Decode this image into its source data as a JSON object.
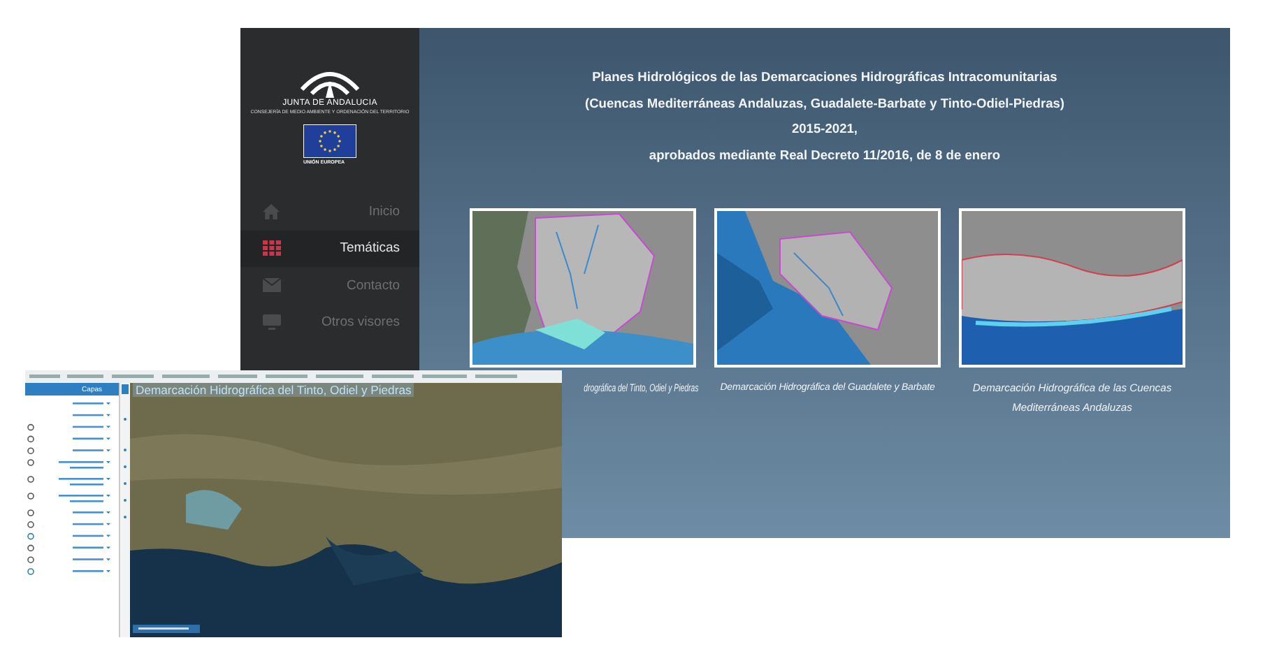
{
  "sidebar": {
    "logo_title": "JUNTA DE ANDALUCIA",
    "logo_subtitle": "CONSEJERÍA DE MEDIO AMBIENTE Y ORDENACIÓN DEL TERRITORIO",
    "eu_label": "UNIÓN EUROPEA",
    "items": [
      {
        "label": "Inicio",
        "kind": "home",
        "selected": false
      },
      {
        "label": "Temáticas",
        "kind": "grid",
        "selected": true
      },
      {
        "label": "Contacto",
        "kind": "mail",
        "selected": false
      },
      {
        "label": "Otros visores",
        "kind": "monitor",
        "selected": false
      }
    ]
  },
  "heading": {
    "lines": [
      "Planes Hidrológicos de las Demarcaciones Hidrográficas Intracomunitarias",
      "(Cuencas Mediterráneas Andaluzas, Guadalete-Barbate y Tinto-Odiel-Piedras)",
      "2015-2021,",
      "aprobados mediante Real Decreto 11/2016, de 8 de enero"
    ]
  },
  "cards": [
    {
      "caption": "drográfica del Tinto, Odiel y Piedras",
      "kind": "west"
    },
    {
      "caption": "Demarcación Hidrográfica del Guadalete y Barbate",
      "kind": "south"
    },
    {
      "caption": "Demarcación Hidrográfica de las Cuencas Mediterráneas Andaluzas",
      "kind": "east"
    }
  ],
  "viewer": {
    "map_title": "Demarcación Hidrográfica del Tinto, Odiel y Piedras",
    "panel_header": "Capas"
  }
}
